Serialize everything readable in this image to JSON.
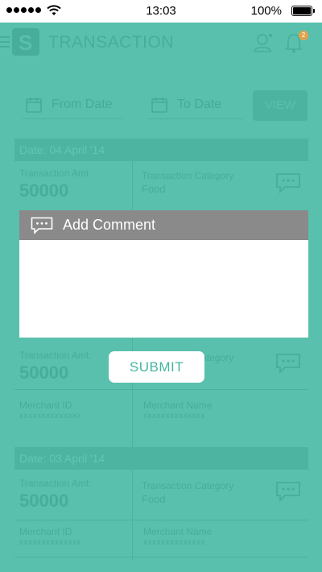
{
  "status_bar": {
    "time": "13:03",
    "battery": "100%"
  },
  "app_bar": {
    "title": "TRANSACTION",
    "notification_count": "2"
  },
  "filters": {
    "from_placeholder": "From Date",
    "to_placeholder": "To Date",
    "view_label": "VIEW"
  },
  "groups": [
    {
      "date_label": "Date: 04 April '14",
      "card": {
        "amount_label": "Transaction Amt.",
        "amount": "50000",
        "category_label": "Transaction Category",
        "category": "Food",
        "merchant_id_label": "Merchant ID",
        "merchant_id": "xxxxxxxxxxxxxx",
        "merchant_name_label": "Merchant Name",
        "merchant_name": "xxxxxxxxxxxxxx"
      },
      "card_lower": {
        "amount_label": "Transaction Amt.",
        "amount": "50000",
        "category_label": "Transaction Category"
      }
    },
    {
      "date_label": "Date: 03 April '14",
      "card": {
        "amount_label": "Transaction Amt.",
        "amount": "50000",
        "category_label": "Transaction Category",
        "category": "Food",
        "merchant_id_label": "Merchant ID",
        "merchant_id": "xxxxxxxxxxxxxx",
        "merchant_name_label": "Merchant Name",
        "merchant_name": "xxxxxxxxxxxxxx"
      }
    }
  ],
  "dialog": {
    "title": "Add Comment",
    "comment_value": "",
    "submit_label": "SUBMIT"
  }
}
